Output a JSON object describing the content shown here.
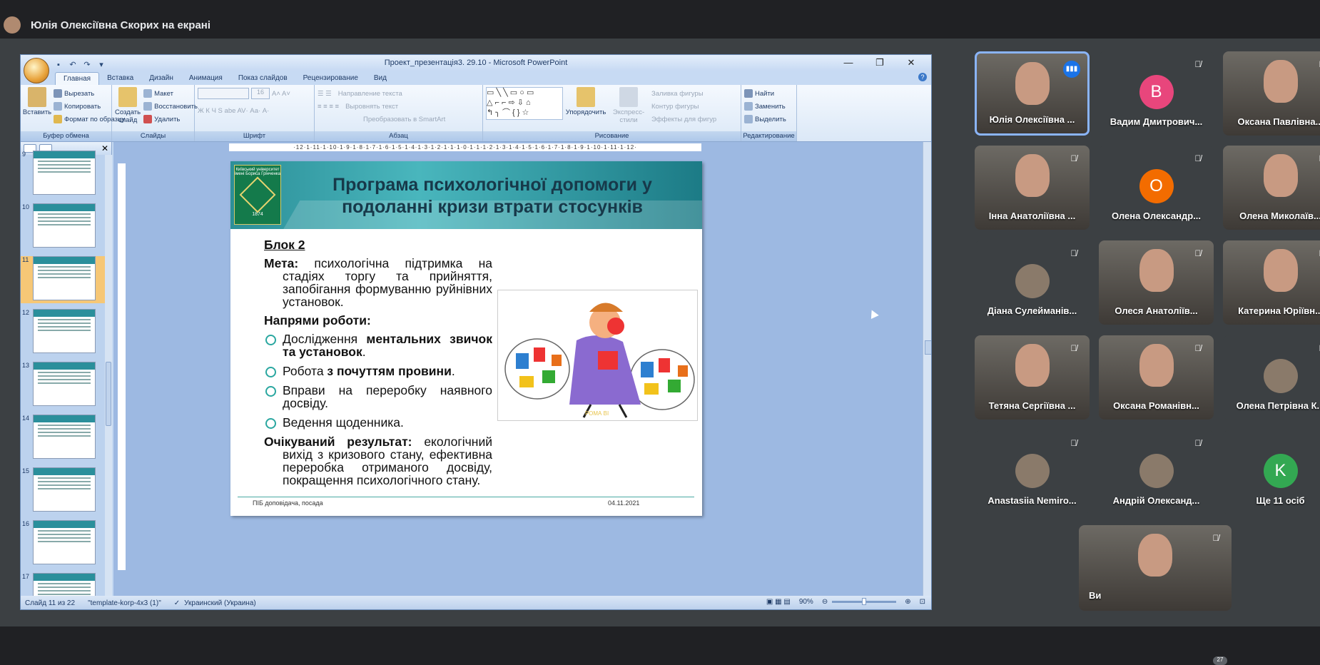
{
  "meet": {
    "presenting_title": "Юлія Олексіївна Скорих на екрані",
    "more_count": "27"
  },
  "ppt": {
    "title": "Проект_презентація3. 29.10 - Microsoft PowerPoint",
    "tabs": [
      "Главная",
      "Вставка",
      "Дизайн",
      "Анимация",
      "Показ слайдов",
      "Рецензирование",
      "Вид"
    ],
    "ribbon": {
      "clipboard": {
        "paste": "Вставить",
        "cut": "Вырезать",
        "copy": "Копировать",
        "format": "Формат по образцу",
        "label": "Буфер обмена"
      },
      "slides": {
        "create": "Создать",
        "create2": "слайд",
        "layout": "Макет",
        "reset": "Восстановить",
        "delete": "Удалить",
        "label": "Слайды"
      },
      "font": {
        "size": "16",
        "label": "Шрифт"
      },
      "paragraph": {
        "direction": "Направление текста",
        "align": "Выровнять текст",
        "smartart": "Преобразовать в SmartArt",
        "label": "Абзац"
      },
      "drawing": {
        "arrange": "Упорядочить",
        "styles": "Экспресс-стили",
        "fill": "Заливка фигуры",
        "outline": "Контур фигуры",
        "effects": "Эффекты для фигур",
        "label": "Рисование"
      },
      "editing": {
        "find": "Найти",
        "replace": "Заменить",
        "select": "Выделить",
        "label": "Редактирование"
      }
    },
    "ruler": "·12·1·11·1·10·1·9·1·8·1·7·1·6·1·5·1·4·1·3·1·2·1·1·1·0·1·1·1·2·1·3·1·4·1·5·1·6·1·7·1·8·1·9·1·10·1·11·1·12·",
    "thumb_nums": [
      "9",
      "10",
      "11",
      "12",
      "13",
      "14",
      "15",
      "16",
      "17"
    ],
    "status": {
      "slide": "Слайд 11 из 22",
      "template": "\"template-korp-4x3 (1)\"",
      "lang": "Украинский (Украина)",
      "zoom": "90%"
    }
  },
  "slide": {
    "logo_text": "Київський університет імені Бориса Грінченка",
    "logo_year": "1874",
    "title": "Програма психологічної допомоги у подоланні кризи втрати стосунків",
    "block": "Блок 2",
    "goal_label": "Мета:",
    "goal_text": " психологічна підтримка на стадіях торгу та прийняття, запобігання формуванню руйнівних установок.",
    "directions": "Напрями роботи:",
    "items": [
      {
        "pre": "Дослідження ",
        "bold": "ментальних звичок та установок",
        "post": "."
      },
      {
        "pre": "Робота ",
        "bold": "з почуттям провини",
        "post": "."
      },
      {
        "pre": "Вправи на переробку наявного досвіду.",
        "bold": "",
        "post": ""
      },
      {
        "pre": "Ведення щоденника.",
        "bold": "",
        "post": ""
      }
    ],
    "result_label": "Очікуваний результат:",
    "result_text": " екологічний вихід з кризового стану, ефективна переробка отриманого досвіду, покращення психологічного стану.",
    "image_sign": "РОМА ВІ",
    "footer_left": "ПІБ доповідача, посада",
    "footer_right": "04.11.2021"
  },
  "participants": [
    {
      "name": "Юлія Олексіївна ...",
      "type": "photo"
    },
    {
      "name": "Вадим Дмитрович...",
      "initial": "В",
      "color": "#e8467c"
    },
    {
      "name": "Оксана Павлівна...",
      "type": "photo"
    },
    {
      "name": "Інна Анатоліївна ...",
      "type": "photo"
    },
    {
      "name": "Олена Олександр...",
      "initial": "О",
      "color": "#f36c00"
    },
    {
      "name": "Олена Миколаїв...",
      "type": "photo"
    },
    {
      "name": "Діана Сулейманів...",
      "type": "small"
    },
    {
      "name": "Олеся Анатоліїв...",
      "type": "photo"
    },
    {
      "name": "Катерина Юріївн...",
      "type": "photo"
    },
    {
      "name": "Тетяна Сергіївна ...",
      "type": "photo"
    },
    {
      "name": "Оксана Романівн...",
      "type": "photo"
    },
    {
      "name": "Олена Петрівна К...",
      "type": "small"
    },
    {
      "name": "Anastasiia Nemiro...",
      "type": "small"
    },
    {
      "name": "Андрій Олександ...",
      "type": "small"
    },
    {
      "name": "Ще 11 осіб",
      "initial": "K",
      "color": "#33a852"
    },
    {
      "name": "Ви",
      "type": "photo"
    }
  ],
  "colors": {
    "meet_bg": "#202124",
    "tile_bg": "#3c4043",
    "active_border": "#8ab4f8",
    "teal": "#2aa7a0"
  }
}
